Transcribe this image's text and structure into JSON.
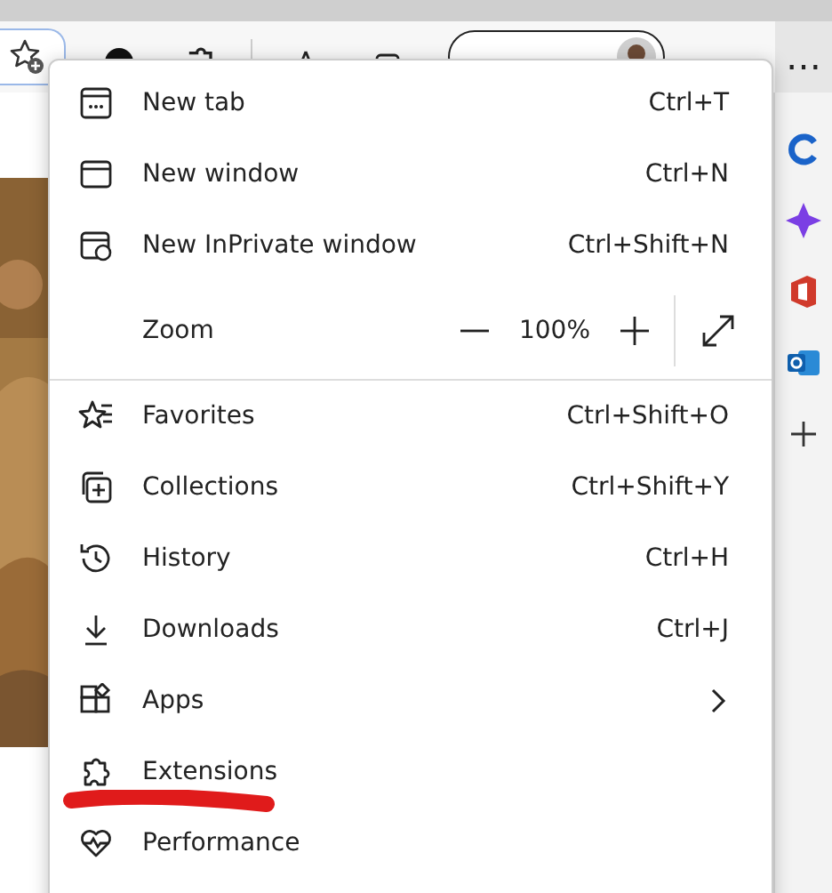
{
  "toolbar": {
    "more_button": "…"
  },
  "menu": {
    "items": [
      {
        "kind": "item",
        "label": "New tab",
        "shortcut": "Ctrl+T"
      },
      {
        "kind": "item",
        "label": "New window",
        "shortcut": "Ctrl+N"
      },
      {
        "kind": "item",
        "label": "New InPrivate window",
        "shortcut": "Ctrl+Shift+N"
      },
      {
        "kind": "zoom",
        "label": "Zoom",
        "value": "100%"
      },
      {
        "kind": "divider"
      },
      {
        "kind": "item",
        "label": "Favorites",
        "shortcut": "Ctrl+Shift+O"
      },
      {
        "kind": "item",
        "label": "Collections",
        "shortcut": "Ctrl+Shift+Y"
      },
      {
        "kind": "item",
        "label": "History",
        "shortcut": "Ctrl+H"
      },
      {
        "kind": "item",
        "label": "Downloads",
        "shortcut": "Ctrl+J"
      },
      {
        "kind": "submenu",
        "label": "Apps"
      },
      {
        "kind": "item",
        "label": "Extensions",
        "underlined": true
      },
      {
        "kind": "item",
        "label": "Performance"
      }
    ]
  }
}
